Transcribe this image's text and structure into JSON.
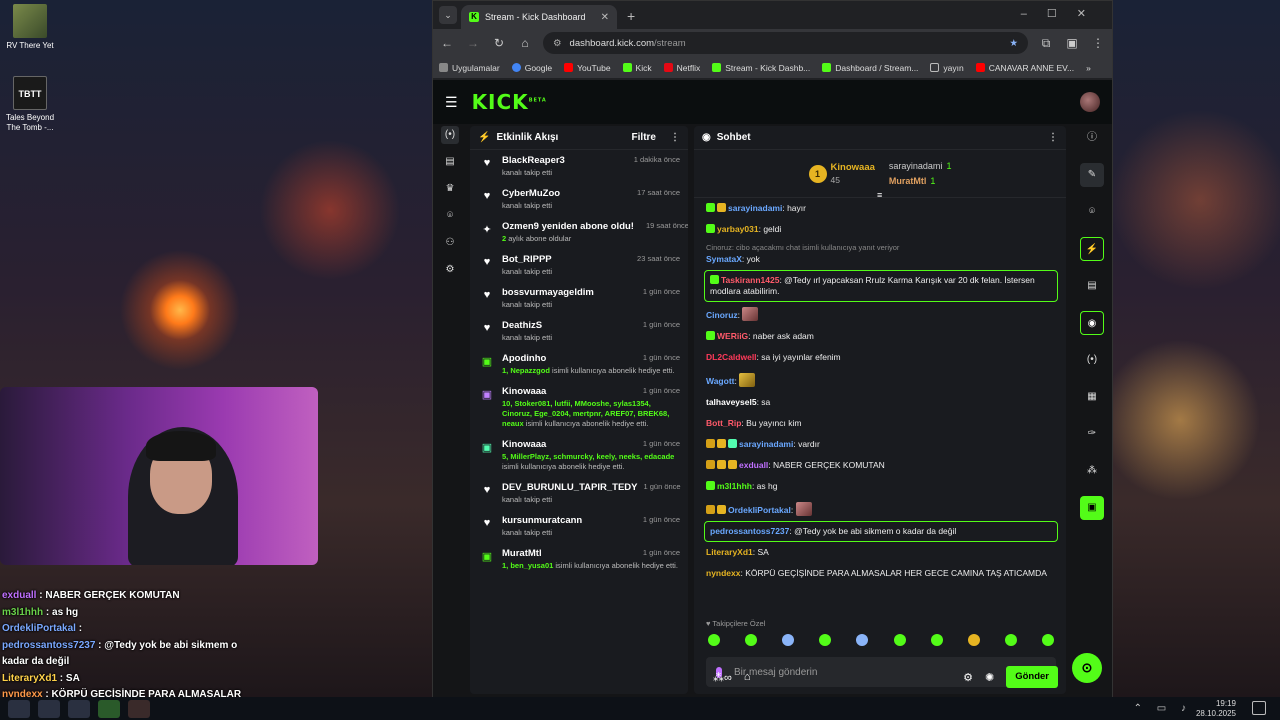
{
  "desktop": {
    "icons": [
      {
        "label": "RV There Yet"
      },
      {
        "label": "Tales Beyond The Tomb -..."
      }
    ],
    "overlay_chat": [
      {
        "user": "exduall",
        "text": " : NABER GERÇEK KOMUTAN"
      },
      {
        "user": "m3l1hhh",
        "text": " : as hg"
      },
      {
        "user": "OrdekliPortakal",
        "text": " :"
      },
      {
        "user": "pedrossantoss7237",
        "text": " : @Tedy yok be abi sikmem o kadar da değil"
      },
      {
        "user": "LiteraryXd1",
        "text": " : SA"
      },
      {
        "user": "nyndexx",
        "text": " : KÖRPÜ GEÇİŞİNDE PARA ALMASALAR HER GECE CAMINA TAŞ ATICAMDA"
      }
    ]
  },
  "taskbar": {
    "time": "19:19",
    "date": "28.10.2025"
  },
  "browser": {
    "tab_title": "Stream - Kick Dashboard",
    "url_host": "dashboard.kick.com",
    "url_path": "/stream",
    "bookmarks": [
      "Uygulamalar",
      "Google",
      "YouTube",
      "Kick",
      "Netflix",
      "Stream - Kick Dashb...",
      "Dashboard / Stream...",
      "yayın",
      "CANAVAR ANNE EV..."
    ]
  },
  "kick": {
    "logo": "KICK",
    "logo_badge": "BETA",
    "activity": {
      "title": "Etkinlik Akışı",
      "filter": "Filtre",
      "events": [
        {
          "icon": "heart",
          "name": "BlackReaper3",
          "time": "1 dakika önce",
          "desc": "kanalı takip etti"
        },
        {
          "icon": "heart",
          "name": "CyberMuZoo",
          "time": "17 saat önce",
          "desc": "kanalı takip etti"
        },
        {
          "icon": "star",
          "name": "Ozmen9 yeniden abone oldu!",
          "time": "19 saat önce",
          "desc_g": "2",
          "desc": " aylık abone oldular"
        },
        {
          "icon": "heart",
          "name": "Bot_RIPPP",
          "time": "23 saat önce",
          "desc": "kanalı takip etti"
        },
        {
          "icon": "heart",
          "name": "bossvurmayageldim",
          "time": "1 gün önce",
          "desc": "kanalı takip etti"
        },
        {
          "icon": "heart",
          "name": "DeathizS",
          "time": "1 gün önce",
          "desc": "kanalı takip etti"
        },
        {
          "icon": "gift",
          "name": "Apodinho",
          "time": "1 gün önce",
          "desc_g": "1, Nepazzgod",
          "desc": " isimli kullanıcıya abonelik hediye etti."
        },
        {
          "icon": "gift2",
          "name": "Kinowaaa",
          "time": "1 gün önce",
          "desc_g": "10, Stoker081, lutfii, MMooshe, sylas1354, Cinoruz, Ege_0204, mertpnr, AREF07, BREK68, neaux",
          "desc": " isimli kullanıcıya abonelik hediye etti."
        },
        {
          "icon": "gift3",
          "name": "Kinowaaa",
          "time": "1 gün önce",
          "desc_g": "5, MillerPlayz, schmurcky, keely, neeks, edacade",
          "desc": " isimli kullanıcıya abonelik hediye etti."
        },
        {
          "icon": "heart",
          "name": "DEV_BURUNLU_TAPIR_TEDY",
          "time": "1 gün önce",
          "desc": "kanalı takip etti"
        },
        {
          "icon": "heart",
          "name": "kursunmuratcann",
          "time": "1 gün önce",
          "desc": "kanalı takip etti"
        },
        {
          "icon": "gift",
          "name": "MuratMtl",
          "time": "1 gün önce",
          "desc_g": "1, ben_yusa01",
          "desc": " isimli kullanıcıya abonelik hediye etti."
        }
      ]
    },
    "chat": {
      "title": "Sohbet",
      "leaderboard": {
        "top_rank": "1",
        "top_name": "Kinowaaa",
        "top_count": "45",
        "side": [
          {
            "name": "sarayinadami",
            "count": "1"
          },
          {
            "name": "MuratMtl",
            "count": "1"
          }
        ]
      },
      "messages": [
        {
          "user": "sarayinadami",
          "color": "#6aa8ff",
          "text": ": hayır"
        },
        {
          "user": "yarbay031",
          "color": "#e6b422",
          "text": ": geldi"
        },
        {
          "reply": "Cinoruz: cibo açacakmı chat isimli kullanıcıya yanıt veriyor"
        },
        {
          "user": "SymataX",
          "color": "#6aa8ff",
          "text": ": yok"
        },
        {
          "user": "Taskirann1425",
          "color": "#ff5a6a",
          "text": ": @Tedy ırl yapcaksan Rrulz Karma Karışık var 20 dk felan. İstersen modlara atabilirim.",
          "hl": true
        },
        {
          "user": "Cinoruz",
          "color": "#6aa8ff",
          "text": ":"
        },
        {
          "user": "WERiiG",
          "color": "#ff5a6a",
          "text": ": naber ask adam"
        },
        {
          "user": "DL2Caldwell",
          "color": "#ff3a5a",
          "text": ": sa iyi yayınlar efenim"
        },
        {
          "user": "Wagott",
          "color": "#6aa8ff",
          "text": ":"
        },
        {
          "user": "talhaveysel5",
          "color": "#ffffff",
          "text": ": sa"
        },
        {
          "user": "Bott_Rip",
          "color": "#ff5a6a",
          "text": ": Bu yayıncı kim"
        },
        {
          "user": "sarayinadami",
          "color": "#6aa8ff",
          "text": ": vardır"
        },
        {
          "user": "exduall",
          "color": "#c070ff",
          "text": ": NABER GERÇEK KOMUTAN"
        },
        {
          "user": "m3l1hhh",
          "color": "#53fc18",
          "text": ": as hg"
        },
        {
          "user": "OrdekliPortakal",
          "color": "#6aa8ff",
          "text": ":"
        },
        {
          "user": "pedrossantoss7237",
          "color": "#6aa8ff",
          "text": ": @Tedy yok be abi sikmem o kadar da değil",
          "hl": true
        },
        {
          "user": "LiteraryXd1",
          "color": "#e6b422",
          "text": ": SA"
        },
        {
          "user": "nyndexx",
          "color": "#e6b422",
          "text": ": KÖRPÜ GEÇİŞİNDE PARA ALMASALAR HER GECE CAMINA TAŞ ATICAMDA"
        }
      ],
      "followers_only": "Takipçilere Özel",
      "input_placeholder": "Bir mesaj gönderin",
      "send_label": "Gönder"
    }
  }
}
